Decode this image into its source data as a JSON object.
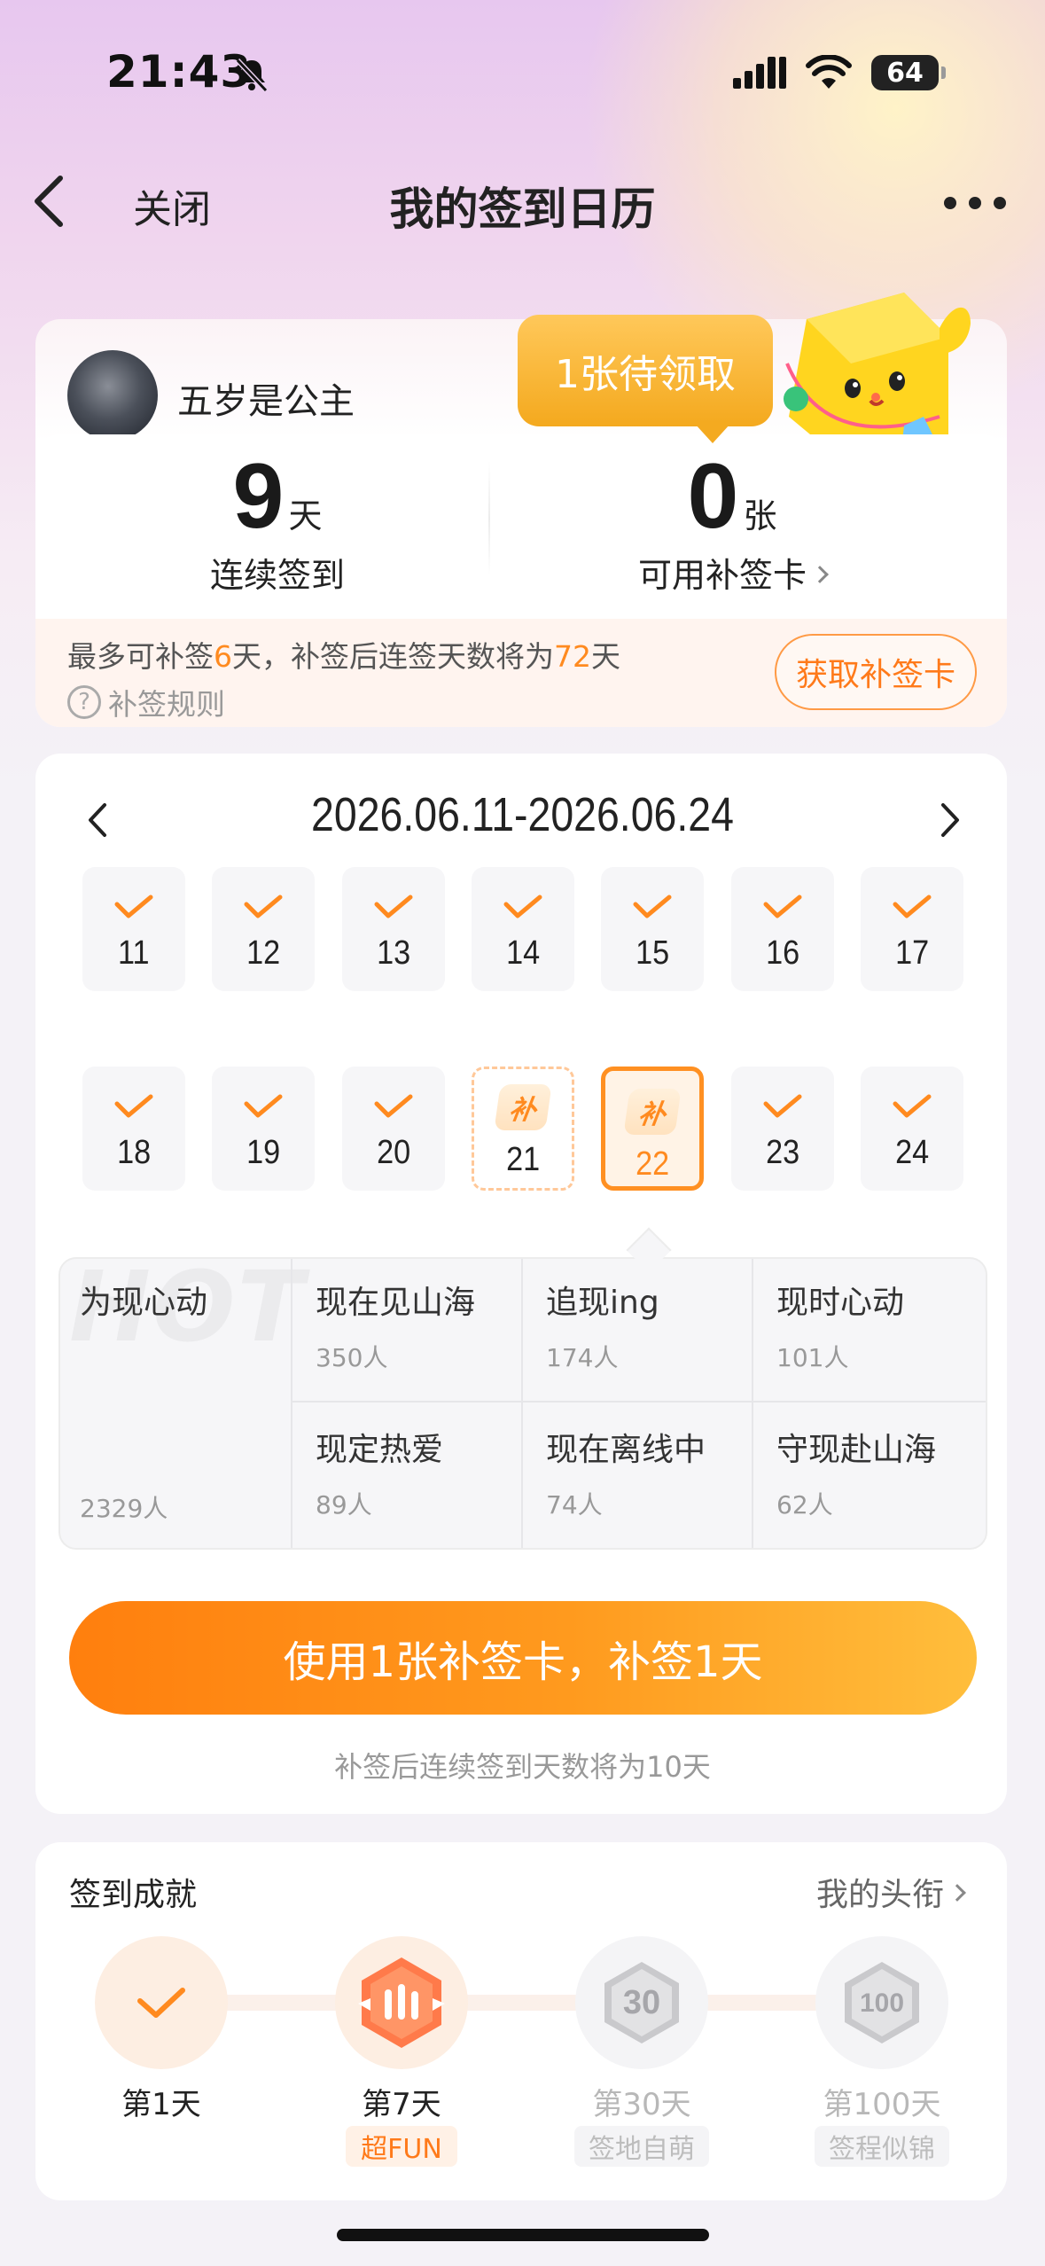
{
  "status_bar": {
    "time": "21:43",
    "battery": "64"
  },
  "nav": {
    "close_label": "关闭",
    "title": "我的签到日历"
  },
  "profile": {
    "username": "五岁是公主"
  },
  "bubble": {
    "text": "1张待领取"
  },
  "stats": {
    "streak": {
      "value": "9",
      "unit": "天",
      "label": "连续签到"
    },
    "cards": {
      "value": "0",
      "unit": "张",
      "label": "可用补签卡"
    }
  },
  "makeup_info": {
    "prefix": "最多可补签",
    "days": "6",
    "middle": "天，补签后连签天数将为",
    "result_days": "72",
    "suffix": "天",
    "rules_label": "补签规则",
    "get_card_label": "获取补签卡"
  },
  "calendar": {
    "range": "2026.06.11-2026.06.24",
    "fix_label": "补",
    "week1": [
      {
        "day": "11",
        "state": "signed"
      },
      {
        "day": "12",
        "state": "signed"
      },
      {
        "day": "13",
        "state": "signed"
      },
      {
        "day": "14",
        "state": "signed"
      },
      {
        "day": "15",
        "state": "signed"
      },
      {
        "day": "16",
        "state": "signed"
      },
      {
        "day": "17",
        "state": "signed"
      }
    ],
    "week2": [
      {
        "day": "18",
        "state": "signed"
      },
      {
        "day": "19",
        "state": "signed"
      },
      {
        "day": "20",
        "state": "signed"
      },
      {
        "day": "21",
        "state": "missed"
      },
      {
        "day": "22",
        "state": "missed-selected"
      },
      {
        "day": "23",
        "state": "signed"
      },
      {
        "day": "24",
        "state": "signed"
      }
    ]
  },
  "groups": {
    "watermark": "HOT",
    "featured": {
      "name": "为现心动",
      "count": "2329人"
    },
    "items": [
      {
        "name": "现在见山海",
        "count": "350人"
      },
      {
        "name": "追现ing",
        "count": "174人"
      },
      {
        "name": "现时心动",
        "count": "101人"
      },
      {
        "name": "现定热爱",
        "count": "89人"
      },
      {
        "name": "现在离线中",
        "count": "74人"
      },
      {
        "name": "守现赴山海",
        "count": "62人"
      }
    ]
  },
  "action": {
    "button_label": "使用1张补签卡，补签1天",
    "hint": "补签后连续签到天数将为10天"
  },
  "achievements": {
    "title": "签到成就",
    "link": "我的头衔",
    "items": [
      {
        "label": "第1天",
        "tag": "",
        "state": "done"
      },
      {
        "label": "第7天",
        "tag": "超FUN",
        "state": "done"
      },
      {
        "label": "第30天",
        "tag": "签地自萌",
        "state": "locked"
      },
      {
        "label": "第100天",
        "tag": "签程似锦",
        "state": "locked"
      }
    ]
  },
  "colors": {
    "accent": "#ff8a1f",
    "bubble": "#f4a91e",
    "button_start": "#ff7f0e",
    "button_end": "#ffbe3c"
  }
}
